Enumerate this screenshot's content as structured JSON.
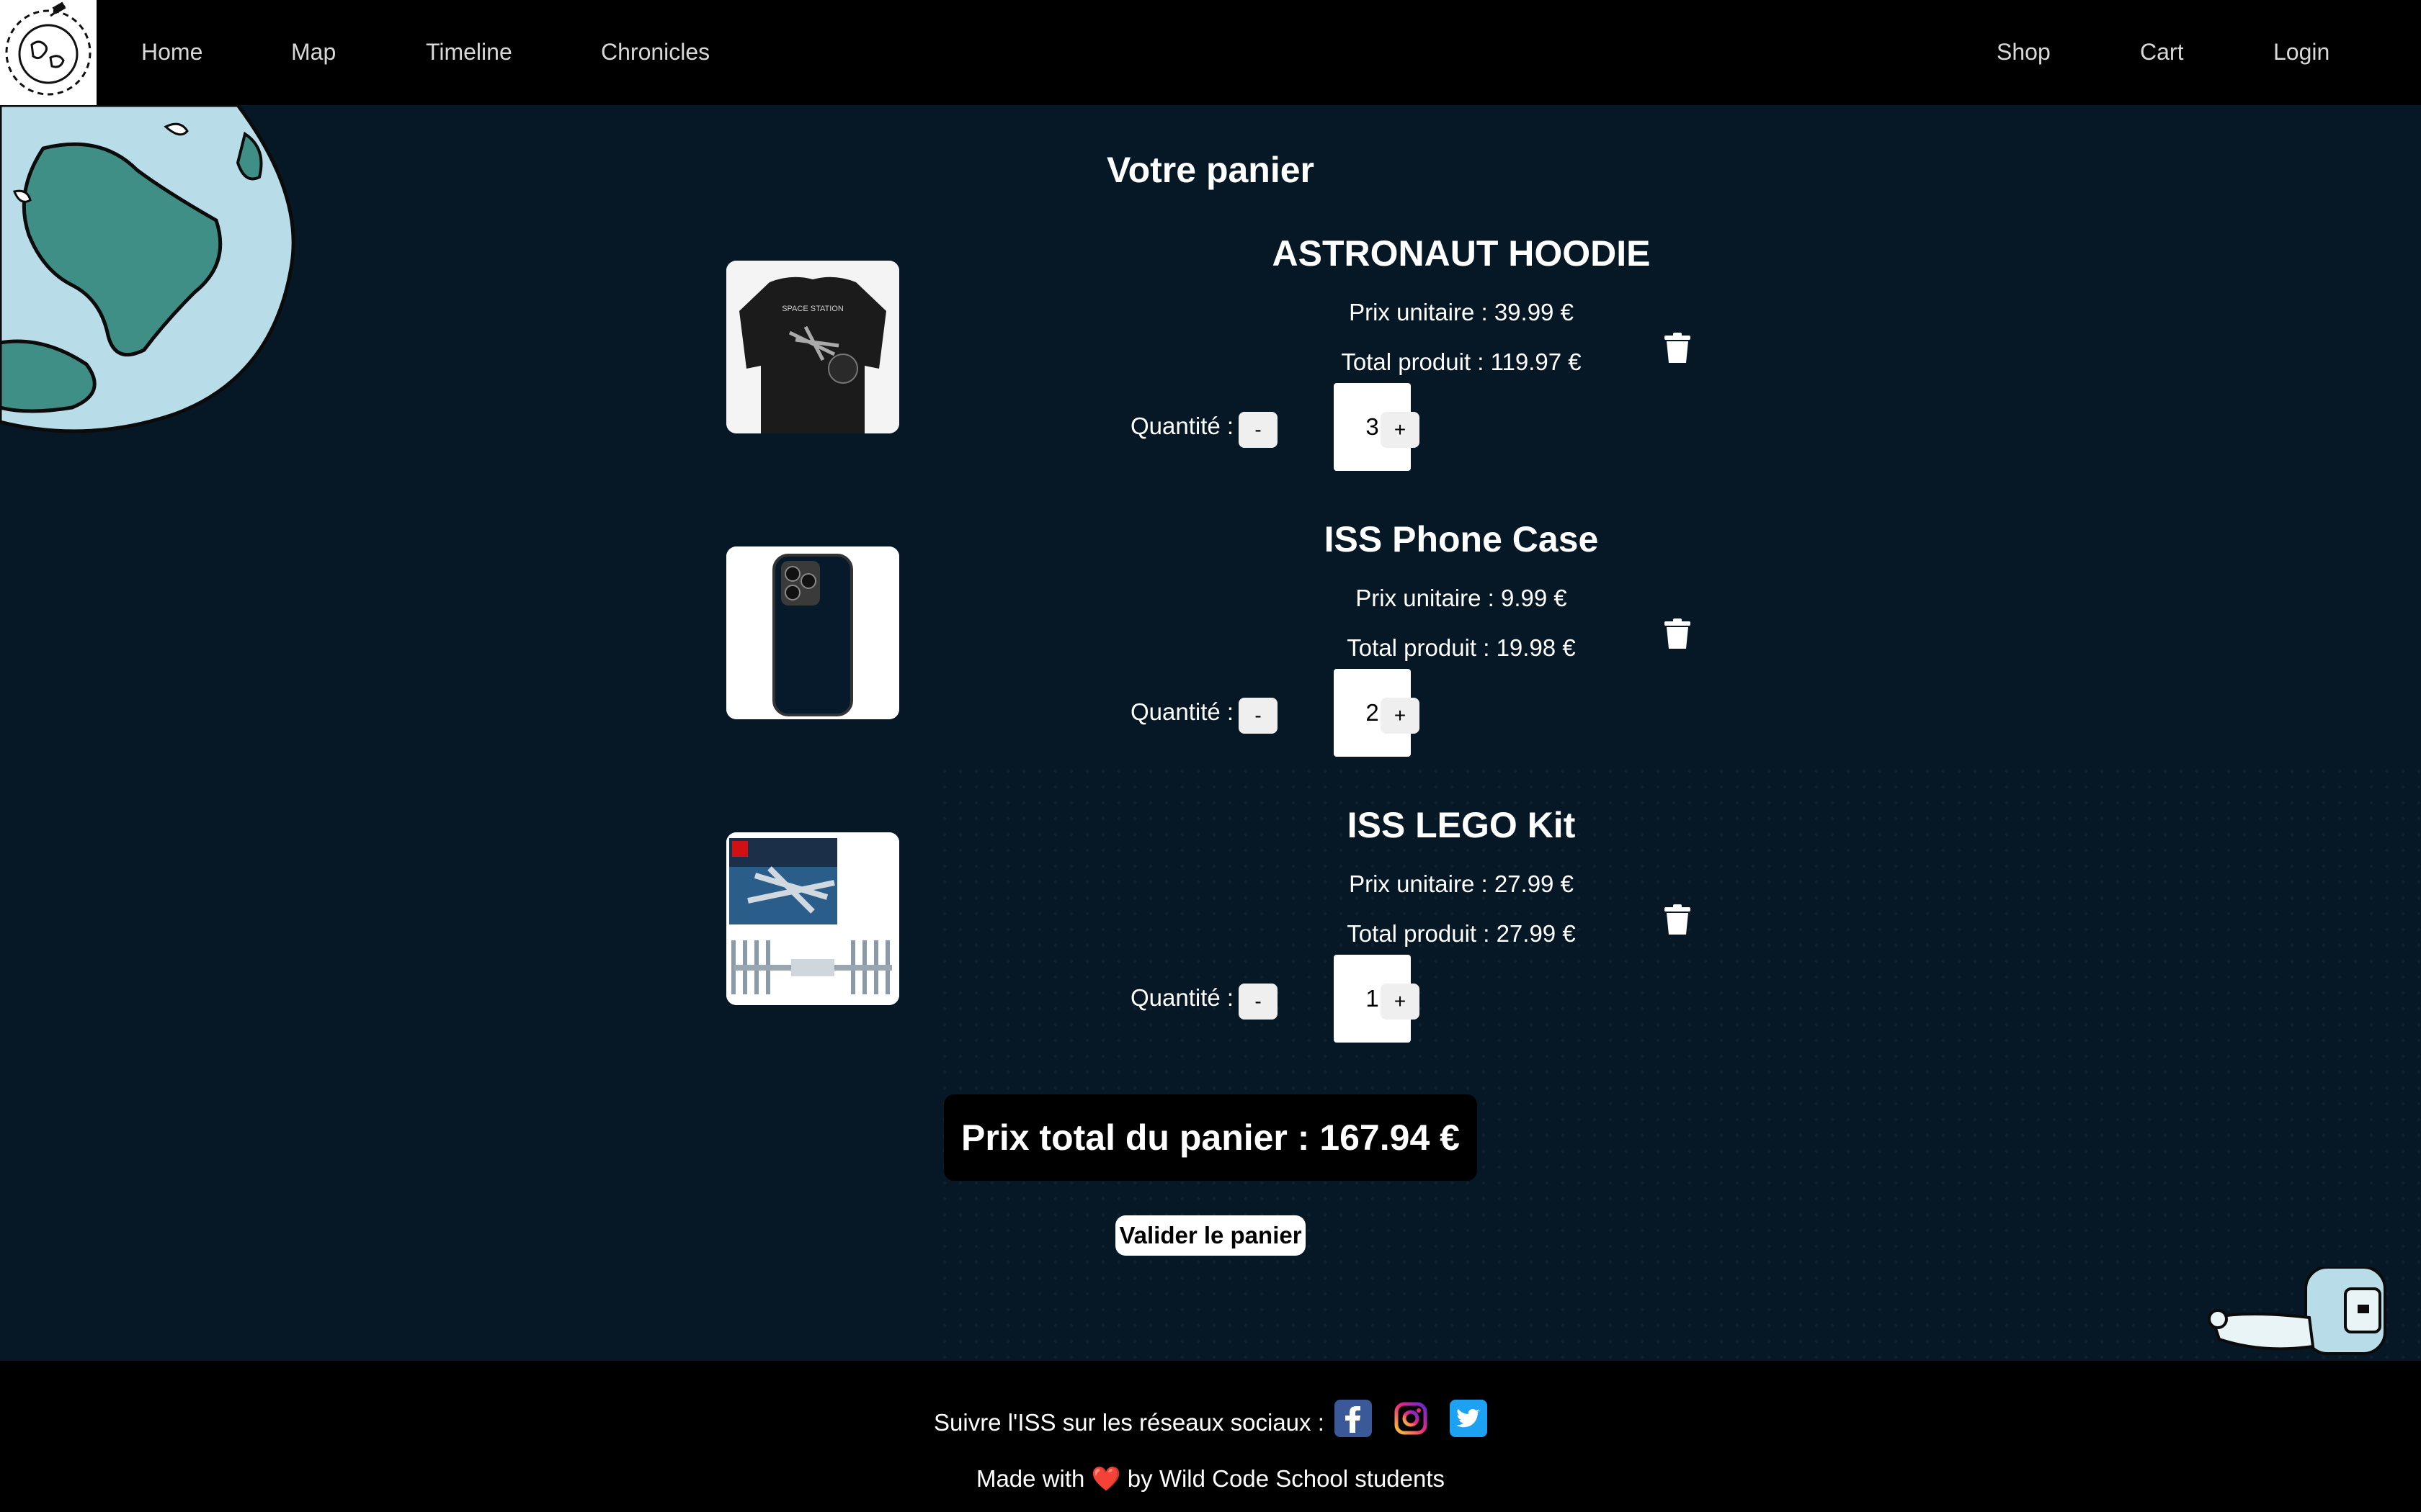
{
  "nav": {
    "left": [
      "Home",
      "Map",
      "Timeline",
      "Chronicles"
    ],
    "right": [
      "Shop",
      "Cart",
      "Login"
    ]
  },
  "cart": {
    "title": "Votre panier",
    "items": [
      {
        "name": "ASTRONAUT HOODIE",
        "unit_price": "Prix unitaire : 39.99 €",
        "total": "Total produit : 119.97 €",
        "qty_label": "Quantité :",
        "quantity": "3",
        "minus": "-",
        "plus": "+",
        "image": "black-tshirt-space-station"
      },
      {
        "name": "ISS Phone Case",
        "unit_price": "Prix unitaire : 9.99 €",
        "total": "Total produit : 19.98 €",
        "qty_label": "Quantité :",
        "quantity": "2",
        "minus": "-",
        "plus": "+",
        "image": "navy-phone-case"
      },
      {
        "name": "ISS LEGO Kit",
        "unit_price": "Prix unitaire : 27.99 €",
        "total": "Total produit : 27.99 €",
        "qty_label": "Quantité :",
        "quantity": "1",
        "minus": "-",
        "plus": "+",
        "image": "lego-iss-box"
      }
    ],
    "total_label": "Prix total du panier : 167.94 €",
    "validate_label": "Valider le panier"
  },
  "footer": {
    "social_text": "Suivre l'ISS sur les réseaux sociaux :",
    "social_icons": [
      "facebook-icon",
      "instagram-icon",
      "twitter-icon"
    ],
    "made_prefix": "Made with",
    "heart": "❤️",
    "made_suffix": "by Wild Code School students"
  },
  "colors": {
    "background": "#061826",
    "navbar": "#000000",
    "facebook": "#3b5998",
    "twitter": "#1da1f2",
    "heart": "#e0245e"
  }
}
